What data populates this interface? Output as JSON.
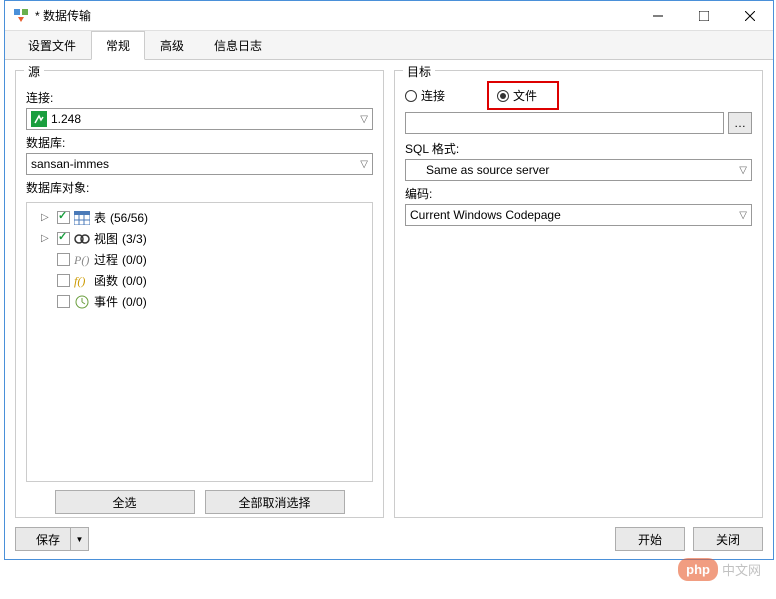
{
  "window": {
    "title": "* 数据传输"
  },
  "tabs": [
    "设置文件",
    "常规",
    "高级",
    "信息日志"
  ],
  "source": {
    "group_label": "源",
    "conn_label": "连接:",
    "conn_value": "1.248",
    "db_label": "数据库:",
    "db_value": "sansan-immes",
    "objects_label": "数据库对象:",
    "tree": [
      {
        "icon": "table",
        "label": "表",
        "count": "(56/56)",
        "checked": true,
        "expandable": true
      },
      {
        "icon": "view",
        "label": "视图",
        "count": "(3/3)",
        "checked": true,
        "expandable": true
      },
      {
        "icon": "proc",
        "label": "过程",
        "count": "(0/0)",
        "checked": false,
        "expandable": false
      },
      {
        "icon": "func",
        "label": "函数",
        "count": "(0/0)",
        "checked": false,
        "expandable": false
      },
      {
        "icon": "event",
        "label": "事件",
        "count": "(0/0)",
        "checked": false,
        "expandable": false
      }
    ],
    "select_all": "全选",
    "deselect_all": "全部取消选择"
  },
  "target": {
    "group_label": "目标",
    "radio_conn": "连接",
    "radio_file": "文件",
    "file_value": "",
    "sql_format_label": "SQL 格式:",
    "sql_format_value": "Same as source server",
    "encoding_label": "编码:",
    "encoding_value": "Current Windows Codepage"
  },
  "footer": {
    "save": "保存",
    "start": "开始",
    "close": "关闭"
  },
  "watermark": {
    "badge": "php",
    "text": "中文网"
  }
}
